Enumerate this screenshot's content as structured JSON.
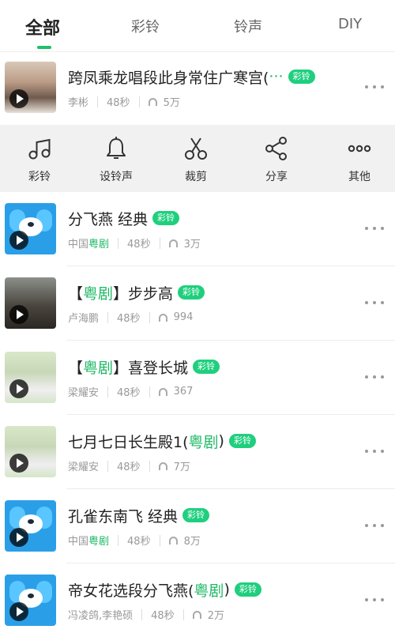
{
  "tabs": {
    "all": "全部",
    "ringback": "彩铃",
    "ringtone": "铃声",
    "diy": "DIY"
  },
  "badge": "彩铃",
  "accent_color": "#1fc06a",
  "actions": [
    {
      "label": "彩铃",
      "icon": "music-note-icon"
    },
    {
      "label": "设铃声",
      "icon": "bell-icon"
    },
    {
      "label": "裁剪",
      "icon": "scissors-icon"
    },
    {
      "label": "分享",
      "icon": "share-icon"
    },
    {
      "label": "其他",
      "icon": "more-horizontal-icon"
    }
  ],
  "songs": [
    {
      "title_pre": "跨凤乘龙唱段此身常住广寒宫(",
      "title_hl": "···",
      "title_post": "",
      "artist_pre": "李彬",
      "artist_hl": "",
      "duration": "48秒",
      "plays": "5万"
    },
    {
      "title_pre": "分飞燕 经典",
      "title_hl": "",
      "title_post": "",
      "artist_pre": "中国",
      "artist_hl": "粤剧",
      "duration": "48秒",
      "plays": "3万"
    },
    {
      "title_pre": "【",
      "title_hl": "粤剧",
      "title_post": "】步步高",
      "artist_pre": "卢海鹏",
      "artist_hl": "",
      "duration": "48秒",
      "plays": "994"
    },
    {
      "title_pre": "【",
      "title_hl": "粤剧",
      "title_post": "】喜登长城",
      "artist_pre": "梁耀安",
      "artist_hl": "",
      "duration": "48秒",
      "plays": "367"
    },
    {
      "title_pre": "七月七日长生殿1(",
      "title_hl": "粤剧",
      "title_post": ")",
      "artist_pre": "梁耀安",
      "artist_hl": "",
      "duration": "48秒",
      "plays": "7万"
    },
    {
      "title_pre": "孔雀东南飞 经典",
      "title_hl": "",
      "title_post": "",
      "artist_pre": "中国",
      "artist_hl": "粤剧",
      "duration": "48秒",
      "plays": "8万"
    },
    {
      "title_pre": "帝女花选段分飞燕(",
      "title_hl": "粤剧",
      "title_post": ")",
      "artist_pre": "冯凌鸽,李艳硕",
      "artist_hl": "",
      "duration": "48秒",
      "plays": "2万"
    }
  ]
}
